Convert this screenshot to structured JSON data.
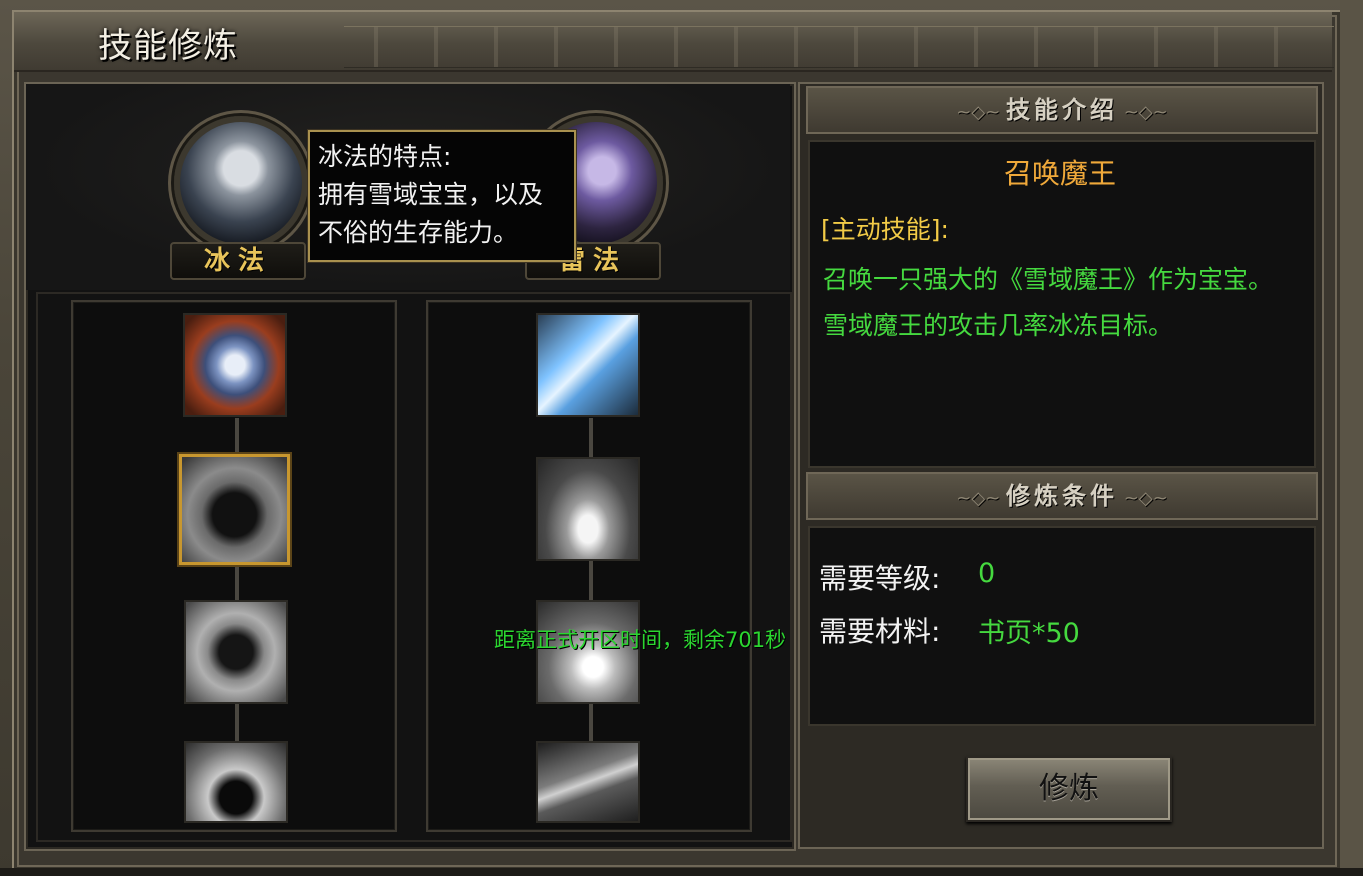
{
  "window": {
    "title": "技能修炼"
  },
  "classes": [
    {
      "name": "冰法",
      "portrait": "ice-mage-portrait"
    },
    {
      "name": "雷法",
      "portrait": "thunder-mage-portrait"
    }
  ],
  "tooltip": {
    "line1": "冰法的特点:",
    "line2": "拥有雪域宝宝，以及",
    "line3": "不俗的生存能力。"
  },
  "skill_tree": {
    "left": [
      {
        "icon": "shield-skill-icon",
        "selected": false
      },
      {
        "icon": "horned-helm-skill-icon",
        "selected": true
      },
      {
        "icon": "demon-mask-skill-icon",
        "selected": false
      },
      {
        "icon": "raised-hand-skill-icon",
        "selected": false
      }
    ],
    "right": [
      {
        "icon": "ice-cross-skill-icon",
        "selected": false
      },
      {
        "icon": "ground-spikes-skill-icon",
        "selected": false
      },
      {
        "icon": "light-burst-skill-icon",
        "selected": false
      },
      {
        "icon": "lightning-bolt-skill-icon",
        "selected": false
      }
    ]
  },
  "server_notice": "距离正式开区时间，剩余701秒",
  "intro": {
    "header": "技能介绍",
    "skill_name": "召唤魔王",
    "skill_type": "[主动技能]:",
    "desc1": "召唤一只强大的《雪域魔王》作为宝宝。",
    "desc2": "雪域魔王的攻击几率冰冻目标。"
  },
  "conditions": {
    "header": "修炼条件",
    "level_label": "需要等级:",
    "level_value": "0",
    "material_label": "需要材料:",
    "material_value": "书页*50"
  },
  "actions": {
    "train_label": "修炼"
  },
  "colors": {
    "accent_gold": "#e8c45a",
    "desc_green": "#45d93f",
    "name_orange": "#f0a93a",
    "selected_border": "#c8972f"
  }
}
